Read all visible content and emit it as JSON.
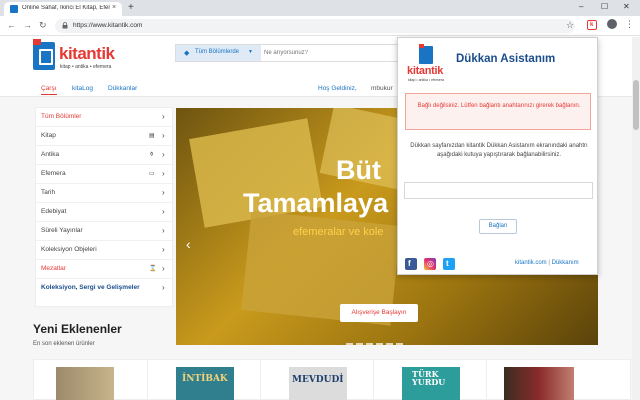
{
  "browser": {
    "tab_title": "Online Sahaf, İkinci El Kitap, Efem",
    "tab_close": "×",
    "new_tab": "+",
    "url": "https://www.kitantik.com",
    "controls": {
      "minimize": "–",
      "maximize": "☐",
      "close": "✕"
    }
  },
  "site": {
    "logo_text": "kitantik",
    "logo_sub": "kitap • antika • efemera",
    "search": {
      "category_label": "Tüm Bölümlerde",
      "placeholder": "Ne arıyorsunuz?"
    },
    "subnav": {
      "cart": "Çarşı",
      "kitalog": "kitaLog",
      "dukkanlar": "Dükkanlar",
      "hello": "Hoş Geldiniz,",
      "user": "mbukur"
    },
    "categories": [
      {
        "label": "Tüm Bölümler",
        "color": "#e53935",
        "icon": ""
      },
      {
        "label": "Kitap",
        "color": "#444444",
        "icon": "▤"
      },
      {
        "label": "Antika",
        "color": "#444444",
        "icon": "⚱"
      },
      {
        "label": "Efemera",
        "color": "#444444",
        "icon": "▭"
      },
      {
        "label": "Tarih",
        "color": "#444444",
        "icon": ""
      },
      {
        "label": "Edebiyat",
        "color": "#444444",
        "icon": ""
      },
      {
        "label": "Süreli Yayınlar",
        "color": "#444444",
        "icon": ""
      },
      {
        "label": "Koleksiyon Objeleri",
        "color": "#444444",
        "icon": ""
      },
      {
        "label": "Mezatlar",
        "color": "#e53935",
        "icon": "⌛"
      },
      {
        "label": "Koleksiyon, Sergi ve Gelişmeler",
        "color": "#1a4d8c",
        "icon": ""
      }
    ],
    "banner": {
      "line1": "Büt",
      "line2": "Tamamlaya",
      "sub": "efemeralar ve kole",
      "button": "Alışverişe Başlayın"
    },
    "new_section": {
      "title": "Yeni Eklenenler",
      "subtitle": "En son eklenen ürünler",
      "cover_texts": [
        "İNTİBAK",
        "MEVDUDİ",
        "TÜRK YURDU"
      ]
    }
  },
  "popup": {
    "logo_text": "kitantik",
    "logo_sub": "kitap • antika • efemera",
    "title": "Dükkan Asistanım",
    "alert": "Bağlı değilsiniz. Lütfen bağlantı anahtarınızı girerek bağlanın.",
    "description": "Dükkan sayfanızdan kitantik Dükkan Asistanım ekranındaki anahtrı aşağıdaki kutuya yapıştırarak bağlanabilirsiniz.",
    "input_value": "",
    "connect_button": "Bağlan",
    "footer_link1": "kitantik.com",
    "footer_sep": "|",
    "footer_link2": "Dükkanım"
  },
  "colors": {
    "brand_red": "#e53935",
    "brand_blue": "#1a74c4",
    "title_navy": "#1a4d8c"
  }
}
